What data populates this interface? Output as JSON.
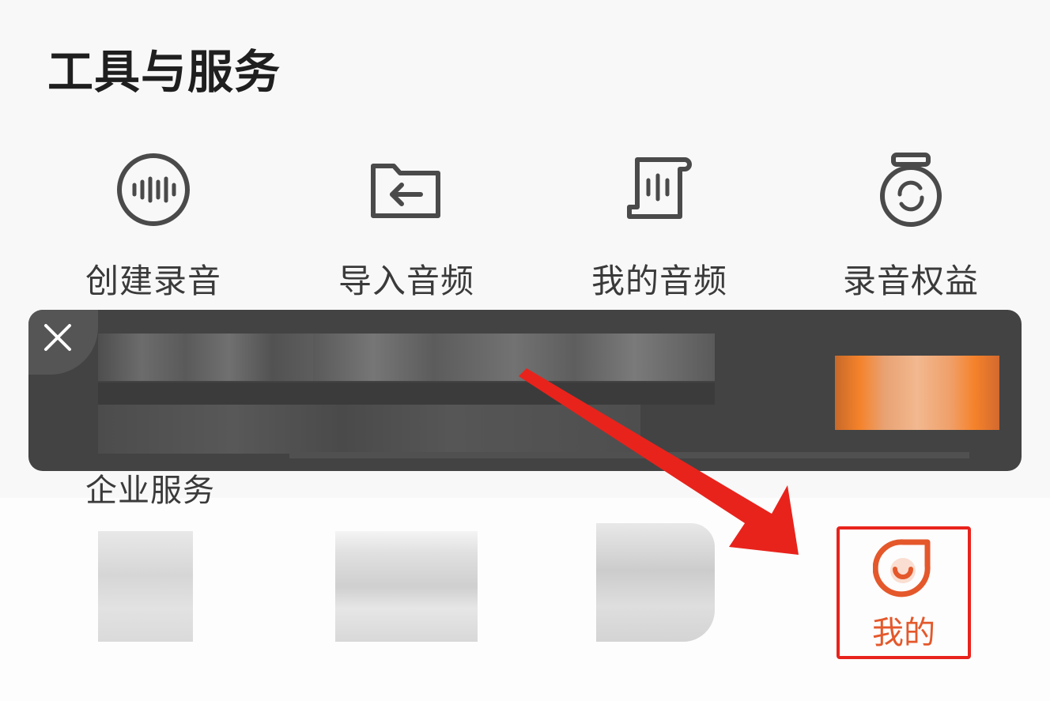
{
  "tools_section": {
    "title": "工具与服务",
    "items": [
      {
        "label": "创建录音",
        "icon": "waveform-circle-icon"
      },
      {
        "label": "导入音频",
        "icon": "folder-import-icon"
      },
      {
        "label": "我的音频",
        "icon": "audio-scroll-icon"
      },
      {
        "label": "录音权益",
        "icon": "refresh-badge-icon"
      }
    ]
  },
  "toast": {
    "close_icon": "close-icon",
    "cta_color": "#f5822a"
  },
  "enterprise_section": {
    "title": "企业服务",
    "selected_item": {
      "label": "我的",
      "icon": "orange-mascot-icon"
    }
  },
  "colors": {
    "accent": "#e4582b",
    "highlight_border": "#e8231c",
    "arrow": "#e8231c"
  }
}
